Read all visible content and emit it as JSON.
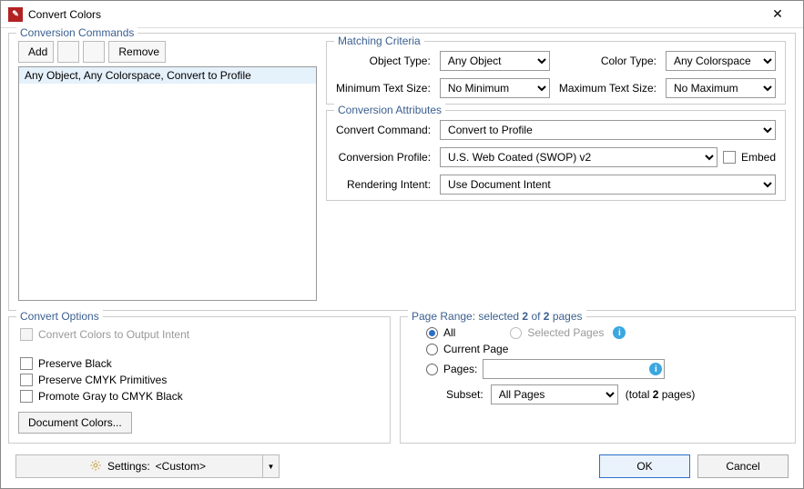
{
  "title": "Convert Colors",
  "group_commands": "Conversion Commands",
  "toolbar": {
    "add": "Add",
    "remove": "Remove"
  },
  "command_list": [
    "Any Object, Any Colorspace, Convert to Profile"
  ],
  "matching": {
    "title": "Matching Criteria",
    "object_type_label": "Object Type:",
    "object_type": "Any Object",
    "color_type_label": "Color Type:",
    "color_type": "Any Colorspace",
    "min_text_label": "Minimum Text Size:",
    "min_text": "No Minimum",
    "max_text_label": "Maximum Text Size:",
    "max_text": "No Maximum"
  },
  "conversion": {
    "title": "Conversion Attributes",
    "command_label": "Convert Command:",
    "command": "Convert to Profile",
    "profile_label": "Conversion Profile:",
    "profile": "U.S. Web Coated (SWOP) v2",
    "embed": "Embed",
    "intent_label": "Rendering Intent:",
    "intent": "Use Document Intent"
  },
  "convert_options": {
    "title": "Convert Options",
    "to_output_intent": "Convert Colors to Output Intent",
    "preserve_black": "Preserve Black",
    "preserve_cmyk": "Preserve CMYK Primitives",
    "promote_gray": "Promote Gray to CMYK Black",
    "doc_colors": "Document Colors..."
  },
  "page_range": {
    "title_prefix": "Page Range: selected ",
    "title_mid": " of ",
    "title_suffix": " pages",
    "sel": "2",
    "total": "2",
    "all": "All",
    "selected_pages": "Selected Pages",
    "current": "Current Page",
    "pages": "Pages:",
    "subset_label": "Subset:",
    "subset": "All Pages",
    "total_prefix": "(total ",
    "total_suffix": " pages)"
  },
  "footer": {
    "settings_label": "Settings:",
    "settings_value": "<Custom>",
    "ok": "OK",
    "cancel": "Cancel"
  }
}
